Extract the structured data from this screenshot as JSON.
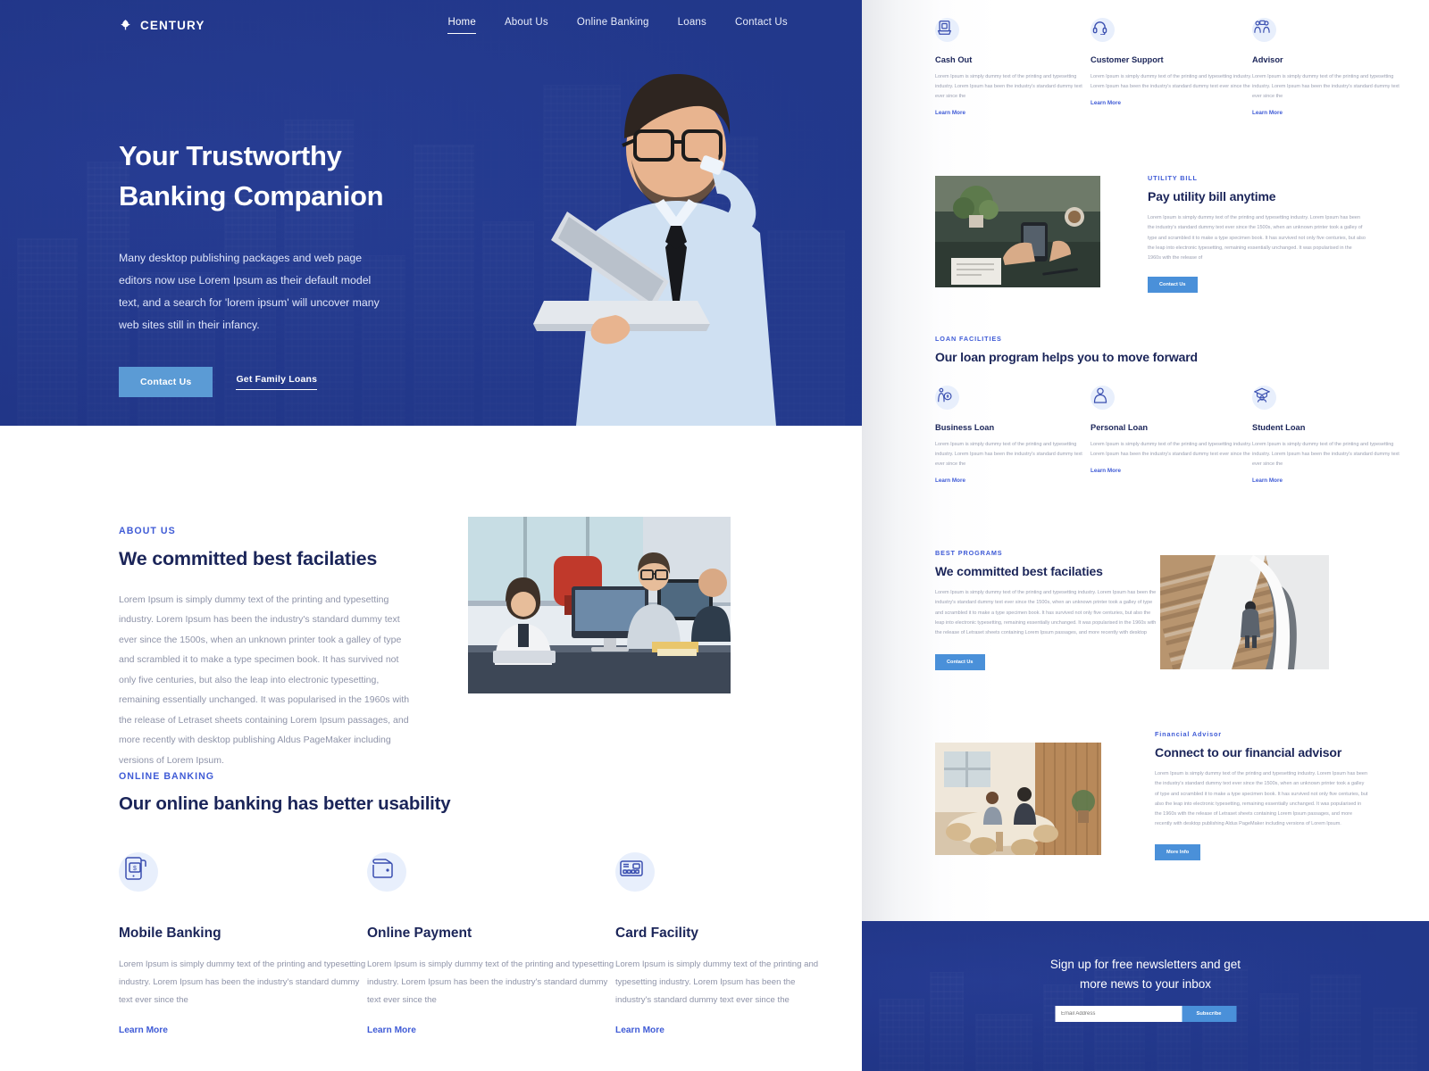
{
  "brand": {
    "name": "CENTURY",
    "icon": "leaf-icon"
  },
  "nav": {
    "items": [
      {
        "label": "Home",
        "active": true
      },
      {
        "label": "About Us",
        "active": false
      },
      {
        "label": "Online Banking",
        "active": false
      },
      {
        "label": "Loans",
        "active": false
      },
      {
        "label": "Contact Us",
        "active": false
      }
    ]
  },
  "hero": {
    "title_line1": "Your Trustworthy",
    "title_line2": "Banking Companion",
    "subtitle": "Many desktop publishing packages and web page editors now use Lorem Ipsum as their default model text, and a search for 'lorem ipsum' will uncover many web sites still in their infancy.",
    "primary_cta": "Contact Us",
    "secondary_cta": "Get Family Loans"
  },
  "about": {
    "eyebrow": "ABOUT US",
    "title": "We committed best facilaties",
    "body": "Lorem Ipsum is simply dummy text of the printing and typesetting industry. Lorem Ipsum has been the industry's standard dummy text ever since the 1500s, when an unknown printer took a galley of type and scrambled it to make a type specimen book. It has survived not only five centuries, but also the leap into electronic typesetting, remaining essentially unchanged. It was popularised in the 1960s with the release of Letraset sheets containing Lorem Ipsum passages, and more recently with desktop publishing  Aldus PageMaker including versions of Lorem Ipsum.",
    "photo_alt": "office-team-photo"
  },
  "online_banking": {
    "eyebrow": "ONLINE BANKING",
    "title": "Our online banking has better usability",
    "features": [
      {
        "icon": "mobile-banking-icon",
        "title": "Mobile Banking",
        "body": "Lorem Ipsum is simply dummy text of the printing and typesetting industry. Lorem Ipsum has been the industry's standard dummy text ever since the",
        "link": "Learn More"
      },
      {
        "icon": "wallet-icon",
        "title": "Online Payment",
        "body": "Lorem Ipsum is simply dummy text of the printing and typesetting industry. Lorem Ipsum has been the industry's standard dummy text ever since the",
        "link": "Learn More"
      },
      {
        "icon": "card-icon",
        "title": "Card Facility",
        "body": "Lorem Ipsum is simply dummy text of the printing and typesetting industry. Lorem Ipsum has been the industry's standard dummy text ever since the",
        "link": "Learn More"
      }
    ]
  },
  "services": [
    {
      "icon": "atm-icon",
      "title": "Cash Out",
      "body": "Lorem Ipsum is simply dummy text of the printing and typesetting industry. Lorem Ipsum has been the industry's standard dummy text ever since the",
      "link": "Learn More"
    },
    {
      "icon": "headset-icon",
      "title": "Customer Support",
      "body": "Lorem Ipsum is simply dummy text of the printing and typesetting industry. Lorem Ipsum has been the industry's standard dummy text ever since the",
      "link": "Learn More"
    },
    {
      "icon": "advisor-icon",
      "title": "Advisor",
      "body": "Lorem Ipsum is simply dummy text of the printing and typesetting industry. Lorem Ipsum has been the industry's standard dummy text ever since the",
      "link": "Learn More"
    }
  ],
  "utility_bill": {
    "eyebrow": "UTILITY BILL",
    "title": "Pay utility bill anytime",
    "body": "Lorem Ipsum is simply dummy text of the printing and typesetting industry. Lorem Ipsum has been the industry's standard dummy text ever since the 1500s, when an unknown printer took a galley of type and scrambled it to make a type specimen book. It has survived not only five centuries, but also the leap into electronic typesetting, remaining essentially unchanged. It was popularised in the 1960s with the release of",
    "cta": "Contact Us",
    "photo_alt": "paying-bill-photo"
  },
  "loan_facilities": {
    "eyebrow": "LOAN FACILITIES",
    "title": "Our loan program helps you to move forward",
    "items": [
      {
        "icon": "business-loan-icon",
        "title": "Business Loan",
        "body": "Lorem Ipsum is simply dummy text of the printing and typesetting industry. Lorem Ipsum has been the industry's standard dummy text ever since the",
        "link": "Learn More"
      },
      {
        "icon": "personal-loan-icon",
        "title": "Personal Loan",
        "body": "Lorem Ipsum is simply dummy text of the printing and typesetting industry. Lorem Ipsum has been the industry's standard dummy text ever since the",
        "link": "Learn More"
      },
      {
        "icon": "student-loan-icon",
        "title": "Student Loan",
        "body": "Lorem Ipsum is simply dummy text of the printing and typesetting industry. Lorem Ipsum has been the industry's standard dummy text ever since the",
        "link": "Learn More"
      }
    ]
  },
  "best_programs": {
    "eyebrow": "BEST  PROGRAMS",
    "title": "We committed best facilaties",
    "body": "Lorem Ipsum is simply dummy text of the printing and typesetting industry. Lorem Ipsum has been the industry's standard dummy text ever since the 1500s, when an unknown printer took a galley of type and scrambled it to make a type specimen book. It has survived not only five centuries, but also the leap into electronic typesetting, remaining essentially unchanged. It was popularised in the 1960s with the release of Letraset sheets containing Lorem Ipsum passages, and more recently with desktop",
    "cta": "Contact Us",
    "photo_alt": "stairs-aerial-photo"
  },
  "financial_advisor": {
    "eyebrow": "Financial Advisor",
    "title": "Connect to our financial advisor",
    "body": "Lorem Ipsum is simply dummy text of the printing and typesetting industry. Lorem Ipsum has been the industry's standard dummy text ever since the 1500s, when an unknown printer took a galley of type and scrambled it to make a type specimen book. It has survived not only five centuries, but also the leap into electronic typesetting, remaining essentially unchanged. It was popularised in the 1960s with the release of Letraset sheets containing Lorem Ipsum passages, and more recently with desktop publishing  Aldus PageMaker including versions of Lorem Ipsum.",
    "cta": "More Info",
    "photo_alt": "advisor-meeting-photo"
  },
  "newsletter": {
    "title_line1": "Sign up for free newsletters and get",
    "title_line2": "more news to your inbox",
    "placeholder": "Email Address",
    "value": "",
    "button": "Subscribe"
  },
  "colors": {
    "brand_blue": "#2b4499",
    "accent_blue": "#3f5bd6",
    "button_blue": "#4a90d9",
    "hero_button": "#5b9bd5",
    "heading_navy": "#1b2559",
    "body_gray": "#8e93a8"
  }
}
